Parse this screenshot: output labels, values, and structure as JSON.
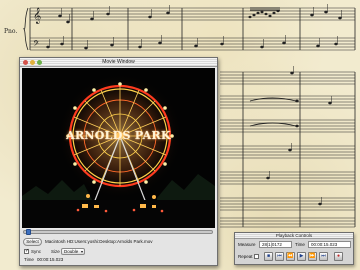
{
  "score": {
    "instrument_label": "Pno."
  },
  "movie_window": {
    "title": "Movie Window",
    "video_caption": "ARNOLDS PARK",
    "select_label": "Select",
    "file_path": "Macintosh HD:Users:yoshi:Desktop:Arnolds Park.mov",
    "sync_label": "Sync",
    "sync_checked": true,
    "size_label": "Size",
    "size_value": "Double",
    "time_label": "Time",
    "time_value": "00:00:15.023"
  },
  "playback_controls": {
    "title": "Playback Controls",
    "measure_label": "Measure",
    "measure_value": "28|1|0172",
    "time_label": "Time",
    "time_value": "00:00:15.023",
    "repeat_label": "Repeat",
    "buttons": [
      {
        "name": "stop-icon",
        "glyph": "■"
      },
      {
        "name": "rewind-start-icon",
        "glyph": "⏮"
      },
      {
        "name": "rewind-icon",
        "glyph": "⏪"
      },
      {
        "name": "play-icon",
        "glyph": "▶"
      },
      {
        "name": "fast-forward-icon",
        "glyph": "⏩"
      },
      {
        "name": "forward-end-icon",
        "glyph": "⏭"
      },
      {
        "name": "record-icon",
        "glyph": "●"
      }
    ],
    "colors": {
      "record": "#c0282a",
      "accent": "#1e3f8a"
    }
  }
}
